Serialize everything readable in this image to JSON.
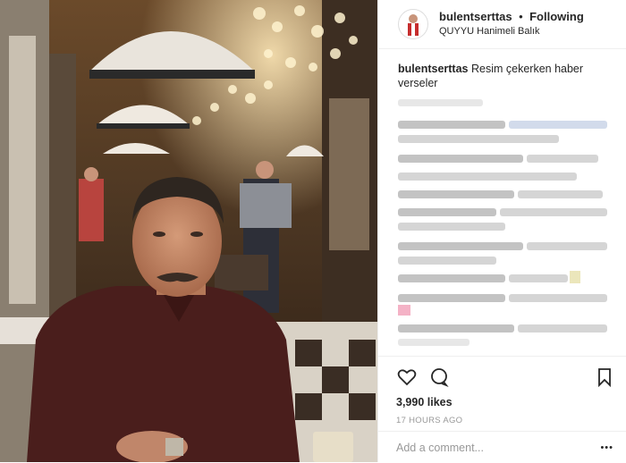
{
  "post": {
    "username": "bulentserttas",
    "separator": "•",
    "follow_label": "Following",
    "location": "QUYYU Hanimeli Balık",
    "caption_text": "Resim çekerken haber verseler",
    "likes": "3,990 likes",
    "timestamp": "17 HOURS AGO",
    "add_comment_placeholder": "Add a comment...",
    "more_label": "•••"
  },
  "colors": {
    "text": "#262626",
    "muted": "#8e8e8e",
    "border": "#efefef",
    "emoji_red": "#e0245e"
  }
}
